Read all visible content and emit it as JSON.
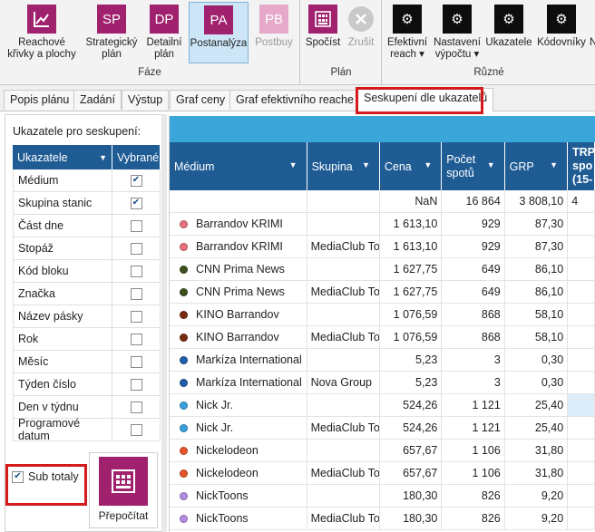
{
  "ribbon": {
    "faze": {
      "label": "Fáze",
      "items": [
        {
          "icon": "chart-icon",
          "line1": "Reachové",
          "line2": "křivky a plochy"
        },
        {
          "icon": "SP",
          "line1": "Strategický",
          "line2": "plán"
        },
        {
          "icon": "DP",
          "line1": "Detailní",
          "line2": "plán"
        },
        {
          "icon": "PA",
          "line1": "Postanalýza",
          "line2": ""
        },
        {
          "icon": "PB",
          "line1": "Postbuy",
          "line2": ""
        }
      ]
    },
    "plan": {
      "label": "Plán",
      "items": [
        {
          "icon": "calculator-icon",
          "line1": "Spočíst"
        },
        {
          "icon": "cancel-icon",
          "line1": "Zrušit"
        }
      ]
    },
    "ruzne": {
      "label": "Různé",
      "items": [
        {
          "icon": "gear-icon",
          "line1": "Efektivní",
          "line2": "reach ▾"
        },
        {
          "icon": "gear-icon",
          "line1": "Nastavení",
          "line2": "výpočtu ▾"
        },
        {
          "icon": "gear-icon",
          "line1": "Ukazatele",
          "line2": ""
        },
        {
          "icon": "gear-icon",
          "line1": "Kódovníky",
          "line2": ""
        },
        {
          "icon": "gear-icon",
          "line1": "N",
          "line2": ""
        }
      ]
    }
  },
  "tabs": [
    "Popis plánu",
    "Zadání",
    "Výstup",
    "Graf ceny",
    "Graf efektivního reache",
    "Seskupení dle ukazatelů"
  ],
  "left_panel": {
    "title": "Ukazatele pro seskupení:",
    "col_ukazatele": "Ukazatele",
    "col_vybrane": "Vybrané",
    "rows": [
      {
        "name": "Médium",
        "checked": true
      },
      {
        "name": "Skupina stanic",
        "checked": true
      },
      {
        "name": "Část dne",
        "checked": false
      },
      {
        "name": "Stopáž",
        "checked": false
      },
      {
        "name": "Kód bloku",
        "checked": false
      },
      {
        "name": "Značka",
        "checked": false
      },
      {
        "name": "Název pásky",
        "checked": false
      },
      {
        "name": "Rok",
        "checked": false
      },
      {
        "name": "Měsíc",
        "checked": false
      },
      {
        "name": "Týden číslo",
        "checked": false
      },
      {
        "name": "Den v týdnu",
        "checked": false
      },
      {
        "name": "Programové datum",
        "checked": false
      }
    ],
    "subtotals_label": "Sub totaly",
    "subtotals_checked": true,
    "recalc_label": "Přepočítat"
  },
  "grid": {
    "columns": {
      "medium": "Médium",
      "skupina": "Skupina",
      "cena": "Cena",
      "pocet_line1": "Počet",
      "pocet_line2": "spotů",
      "grp": "GRP",
      "trp_line1": "TRP",
      "trp_line2": "spo",
      "trp_line3": "(15-"
    },
    "total_row": {
      "cena": "NaN",
      "pocet": "16 864",
      "grp": "3 808,10",
      "extra": "4"
    },
    "rows": [
      {
        "medium": "Barrandov KRIMI",
        "skupina": "",
        "cena": "1 613,10",
        "pocet": "929",
        "grp": "87,30",
        "color": "#e8707a"
      },
      {
        "medium": "Barrandov KRIMI",
        "skupina": "MediaClub To",
        "cena": "1 613,10",
        "pocet": "929",
        "grp": "87,30",
        "color": "#e8707a"
      },
      {
        "medium": "CNN Prima News",
        "skupina": "",
        "cena": "1 627,75",
        "pocet": "649",
        "grp": "86,10",
        "color": "#3f4f1e"
      },
      {
        "medium": "CNN Prima News",
        "skupina": "MediaClub To",
        "cena": "1 627,75",
        "pocet": "649",
        "grp": "86,10",
        "color": "#3f4f1e"
      },
      {
        "medium": "KINO Barrandov",
        "skupina": "",
        "cena": "1 076,59",
        "pocet": "868",
        "grp": "58,10",
        "color": "#7a2b10"
      },
      {
        "medium": "KINO Barrandov",
        "skupina": "MediaClub To",
        "cena": "1 076,59",
        "pocet": "868",
        "grp": "58,10",
        "color": "#7a2b10"
      },
      {
        "medium": "Markíza International",
        "skupina": "",
        "cena": "5,23",
        "pocet": "3",
        "grp": "0,30",
        "color": "#1f5fa8"
      },
      {
        "medium": "Markíza International",
        "skupina": "Nova Group",
        "cena": "5,23",
        "pocet": "3",
        "grp": "0,30",
        "color": "#1f5fa8"
      },
      {
        "medium": "Nick Jr.",
        "skupina": "",
        "cena": "524,26",
        "pocet": "1 121",
        "grp": "25,40",
        "color": "#3aa0dd"
      },
      {
        "medium": "Nick Jr.",
        "skupina": "MediaClub To",
        "cena": "524,26",
        "pocet": "1 121",
        "grp": "25,40",
        "color": "#3aa0dd"
      },
      {
        "medium": "Nickelodeon",
        "skupina": "",
        "cena": "657,67",
        "pocet": "1 106",
        "grp": "31,80",
        "color": "#e8542a"
      },
      {
        "medium": "Nickelodeon",
        "skupina": "MediaClub To",
        "cena": "657,67",
        "pocet": "1 106",
        "grp": "31,80",
        "color": "#e8542a"
      },
      {
        "medium": "NickToons",
        "skupina": "",
        "cena": "180,30",
        "pocet": "826",
        "grp": "9,20",
        "color": "#b58be0"
      },
      {
        "medium": "NickToons",
        "skupina": "MediaClub To",
        "cena": "180,30",
        "pocet": "826",
        "grp": "9,20",
        "color": "#b58be0"
      }
    ]
  },
  "colors": {
    "accent": "#a0216e",
    "header": "#1f5c94",
    "band": "#3aa6d9",
    "highlight": "#d41a1a"
  }
}
